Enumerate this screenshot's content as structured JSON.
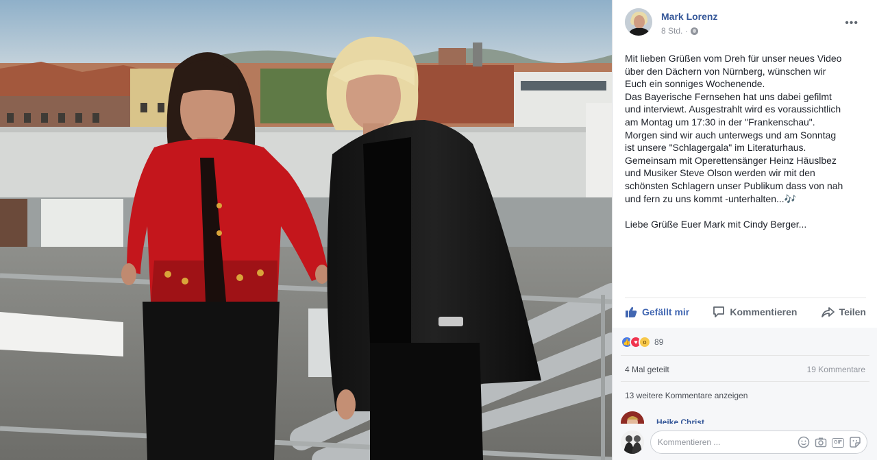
{
  "post": {
    "author": "Mark Lorenz",
    "time": "8 Std. ·",
    "more_label": "•••",
    "text_lines": [
      "Mit lieben Grüßen vom Dreh für unser neues Video",
      "über den Dächern von Nürnberg, wünschen wir",
      "Euch ein sonniges Wochenende.",
      "Das Bayerische Fernsehen hat uns dabei gefilmt",
      "und interviewt. Ausgestrahlt wird es voraussichtlich",
      "am Montag um 17:30 in der \"Frankenschau\".",
      "Morgen sind wir auch unterwegs und am Sonntag",
      "ist unsere \"Schlagergala\" im Literaturhaus.",
      "Gemeinsam mit Operettensänger Heinz Häuslbez",
      "und Musiker Steve Olson werden wir mit den",
      "schönsten Schlagern unser Publikum dass von nah",
      "und fern zu uns kommt -unterhalten...🎶",
      "",
      "Liebe Grüße Euer Mark mit Cindy Berger..."
    ]
  },
  "actions": {
    "like": "Gefällt mir",
    "comment": "Kommentieren",
    "share": "Teilen"
  },
  "stats": {
    "reaction_count": "89",
    "shares": "4 Mal geteilt",
    "comments": "19 Kommentare",
    "more_comments": "13 weitere Kommentare anzeigen"
  },
  "comment_preview": {
    "name": "Heike Christ"
  },
  "composer": {
    "placeholder": "Kommentieren ..."
  },
  "colors": {
    "link": "#365899",
    "like_active": "#4267b2",
    "muted": "#90949c"
  }
}
